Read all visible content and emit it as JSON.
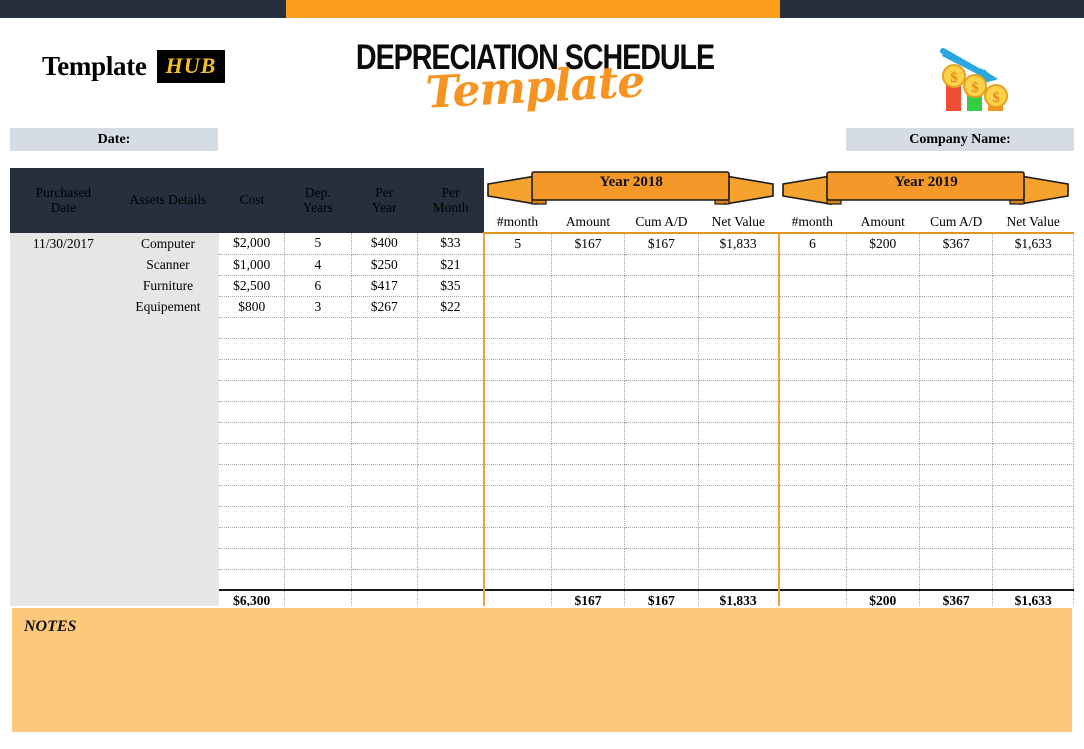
{
  "brand": {
    "logo_primary": "Template",
    "logo_badge": "HUB"
  },
  "header": {
    "title_main": "DEPRECIATION SCHEDULE",
    "title_script": "Template",
    "icon": "declining-bar-chart-icon"
  },
  "fields": {
    "date_label": "Date:",
    "date_value": "",
    "company_label": "Company Name:",
    "company_value": ""
  },
  "table": {
    "base_headers": [
      "Purchased\nDate",
      "Assets Details",
      "Cost",
      "Dep.\nYears",
      "Per\nYear",
      "Per\nMonth"
    ],
    "base_headers_lines": [
      [
        "Purchased",
        "Date"
      ],
      [
        "Assets Details",
        ""
      ],
      [
        "Cost",
        ""
      ],
      [
        "Dep.",
        "Years"
      ],
      [
        "Per",
        "Year"
      ],
      [
        "Per",
        "Month"
      ]
    ],
    "year_sections": [
      {
        "banner": "Year 2018",
        "sub_headers": [
          "#month",
          "Amount",
          "Cum A/D",
          "Net Value"
        ]
      },
      {
        "banner": "Year 2019",
        "sub_headers": [
          "#month",
          "Amount",
          "Cum A/D",
          "Net Value"
        ]
      }
    ],
    "rows": [
      {
        "purchased_date": "11/30/2017",
        "asset": "Computer",
        "cost": "$2,000",
        "dep_years": "5",
        "per_year": "$400",
        "per_month": "$33",
        "y2018": {
          "month": "5",
          "amount": "$167",
          "cum_ad": "$167",
          "net_value": "$1,833"
        },
        "y2019": {
          "month": "6",
          "amount": "$200",
          "cum_ad": "$367",
          "net_value": "$1,633"
        }
      },
      {
        "purchased_date": "",
        "asset": "Scanner",
        "cost": "$1,000",
        "dep_years": "4",
        "per_year": "$250",
        "per_month": "$21",
        "y2018": {
          "month": "",
          "amount": "",
          "cum_ad": "",
          "net_value": ""
        },
        "y2019": {
          "month": "",
          "amount": "",
          "cum_ad": "",
          "net_value": ""
        }
      },
      {
        "purchased_date": "",
        "asset": "Furniture",
        "cost": "$2,500",
        "dep_years": "6",
        "per_year": "$417",
        "per_month": "$35",
        "y2018": {
          "month": "",
          "amount": "",
          "cum_ad": "",
          "net_value": ""
        },
        "y2019": {
          "month": "",
          "amount": "",
          "cum_ad": "",
          "net_value": ""
        }
      },
      {
        "purchased_date": "",
        "asset": "Equipement",
        "cost": "$800",
        "dep_years": "3",
        "per_year": "$267",
        "per_month": "$22",
        "y2018": {
          "month": "",
          "amount": "",
          "cum_ad": "",
          "net_value": ""
        },
        "y2019": {
          "month": "",
          "amount": "",
          "cum_ad": "",
          "net_value": ""
        }
      }
    ],
    "empty_row_count": 13,
    "totals": {
      "cost": "$6,300",
      "dep_years": "",
      "per_year": "",
      "per_month": "",
      "y2018": {
        "month": "",
        "amount": "$167",
        "cum_ad": "$167",
        "net_value": "$1,833"
      },
      "y2019": {
        "month": "",
        "amount": "$200",
        "cum_ad": "$367",
        "net_value": "$1,633"
      }
    }
  },
  "notes": {
    "label": "NOTES",
    "value": ""
  },
  "colors": {
    "dark_navy": "#262f3b",
    "orange": "#fa9e1b",
    "ribbon_orange": "#f59324",
    "notes_bg": "#fcc97c",
    "field_bg": "#d6dce4",
    "gray_block": "#e6e6e6",
    "separator": "#e8a33d"
  }
}
